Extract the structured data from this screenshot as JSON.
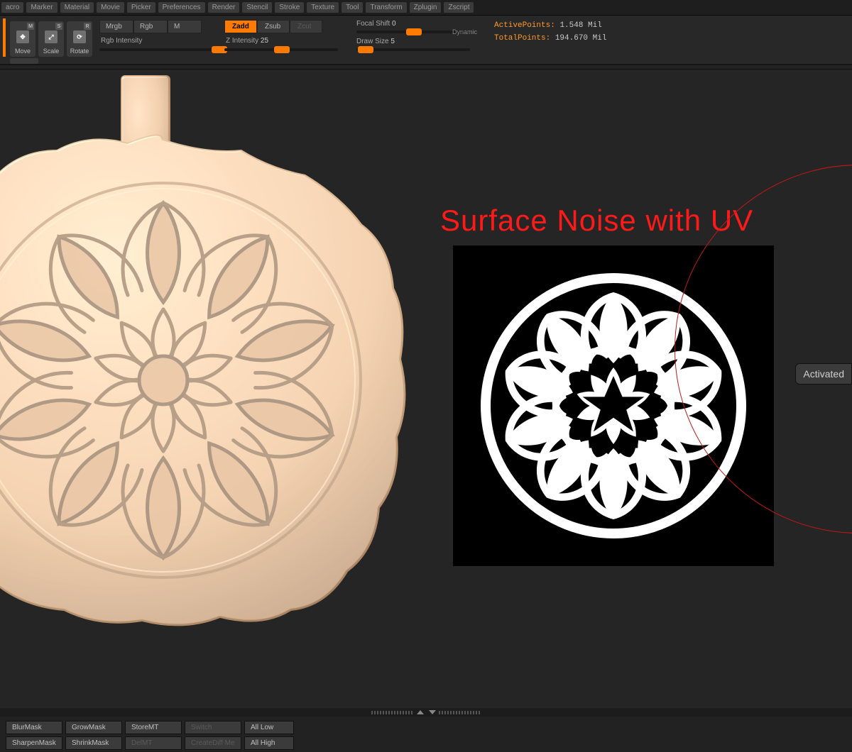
{
  "menu": [
    "acro",
    "Marker",
    "Material",
    "Movie",
    "Picker",
    "Preferences",
    "Render",
    "Stencil",
    "Stroke",
    "Texture",
    "Tool",
    "Transform",
    "Zplugin",
    "Zscript"
  ],
  "gizmo": {
    "move": "Move",
    "scale": "Scale",
    "rotate": "Rotate",
    "m": "M",
    "s": "S",
    "r": "R"
  },
  "modes": {
    "mrgb": "Mrgb",
    "rgb": "Rgb",
    "m": "M",
    "rgbIntensityLabel": "Rgb Intensity"
  },
  "zmode": {
    "zadd": "Zadd",
    "zsub": "Zsub",
    "zcut": "Zcut",
    "zIntensityLabel": "Z Intensity",
    "zIntensityVal": "25"
  },
  "draw": {
    "focalLabel": "Focal Shift",
    "focalVal": "0",
    "sizeLabel": "Draw Size",
    "sizeVal": "5",
    "dynamic": "Dynamic"
  },
  "stats": {
    "activeLabel": "ActivePoints:",
    "activeVal": "1.548 Mil",
    "totalLabel": "TotalPoints:",
    "totalVal": "194.670 Mil"
  },
  "title": "Surface Noise with UV",
  "activated": "Activated",
  "shelf": {
    "row1": [
      "BlurMask",
      "GrowMask",
      "StoreMT",
      "Switch",
      "All Low"
    ],
    "row2": [
      "SharpenMask",
      "ShrinkMask",
      "DelMT",
      "CreateDiff Me",
      "All High"
    ],
    "disabled": [
      "Switch",
      "DelMT",
      "CreateDiff Me"
    ]
  }
}
